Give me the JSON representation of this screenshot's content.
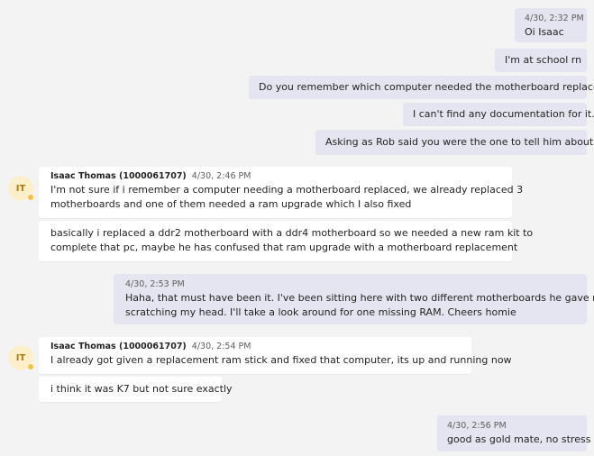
{
  "colors": {
    "background": "#f3f3f3",
    "outgoing_bubble": "#e5e5f1",
    "incoming_bubble": "#ffffff",
    "avatar_bg": "#fcefc9",
    "avatar_text": "#b07b10",
    "status_away": "#f8c337"
  },
  "contact": {
    "name": "Isaac Thomas (1000061707)",
    "initials": "IT",
    "status_icon": "away-clock-icon"
  },
  "messages": {
    "m1": {
      "time": "4/30, 2:32 PM",
      "text": "Oi Isaac"
    },
    "m2": {
      "text": "I'm at school rn"
    },
    "m3": {
      "text": "Do you remember which computer needed the motherboard replaced?"
    },
    "m4": {
      "text": "I can't find any documentation for it."
    },
    "m5": {
      "text": "Asking as Rob said you were the one to tell him about it"
    },
    "m6": {
      "time": "4/30, 2:46 PM",
      "lines": [
        "I'm not sure if i remember a computer needing a motherboard replaced, we already replaced 3",
        "motherboards and one of them needed a ram upgrade which I also fixed"
      ]
    },
    "m7": {
      "lines": [
        "basically i replaced a ddr2 motherboard with a ddr4 motherboard so we needed a new ram kit to",
        "complete that pc, maybe he has confused that ram upgrade with a motherboard replacement"
      ]
    },
    "m8": {
      "time": "4/30, 2:53 PM",
      "lines": [
        "Haha, that must have been it. I've been sitting here with two different motherboards he gave me",
        "scratching my head. I'll take a look around for one missing RAM. Cheers homie"
      ]
    },
    "m9": {
      "time": "4/30, 2:54 PM",
      "text": "I already got given a replacement ram stick and fixed that computer, its up and running now"
    },
    "m10": {
      "text": "i think it was K7 but not sure exactly"
    },
    "m11": {
      "time": "4/30, 2:56 PM",
      "text": "good as gold mate, no stress"
    }
  }
}
